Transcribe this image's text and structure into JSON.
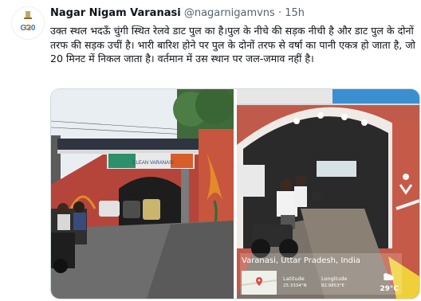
{
  "tweet": {
    "display_name": "Nagar Nigam Varanasi",
    "handle": "@nagarnigamvns",
    "separator": "·",
    "time": "15h",
    "text": "उक्त स्थल भदऊँ चुंगी स्थित रेलवे डाट पुल का है।पुल के नीचे की सड़क नीची है और डाट पुल के दोनों तरफ की सड़क उचीं है। भारी बारिश होने पर पुल के दोनों तरफ से वर्षा का पानी एकत्र हो जाता है, जो 20 मिनट में निकल जाता है। वर्तमान में उस स्थान पर जल-जमाव नहीं है।"
  },
  "avatar": {
    "logo_text": "G20",
    "icon": "g20-emblem-icon"
  },
  "media": {
    "left_photo": {
      "sign_text": "CLEAN VARANASI"
    },
    "right_photo": {
      "location": "Varanasi, Uttar Pradesh, India",
      "latitude_label": "Latitude",
      "latitude_value": "25.3334°N",
      "longitude_label": "Longitude",
      "longitude_value": "82.9853°E",
      "temperature": "29°C",
      "map_icon": "map-pin-icon",
      "weather_icon": "weather-icon"
    }
  },
  "colors": {
    "text": "#0f1419",
    "muted": "#536471",
    "border": "#cfd9de",
    "brick": "#b5453a",
    "bridge": "#c8553d"
  }
}
